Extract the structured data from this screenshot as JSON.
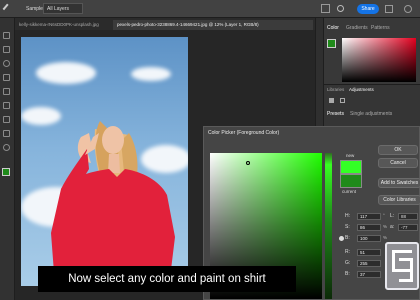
{
  "options": {
    "sample_label": "Sample:",
    "sample_value": "All Layers",
    "share": "Share"
  },
  "tabs": [
    {
      "label": "kelly-sikkema-rN6sDD0PK-unsplash.jpg"
    },
    {
      "label": "pexels-pedro-photo-3238869.4-14669421.jpg @ 12% (Layer 1, RGB/8)"
    }
  ],
  "panel": {
    "tabs": [
      "Color",
      "Gradients",
      "Patterns"
    ],
    "libtabs": [
      "Libraries",
      "Adjustments"
    ],
    "sub": [
      "Presets",
      "Single adjustments"
    ]
  },
  "dialog": {
    "title": "Color Picker (Foreground Color)",
    "new_label": "new",
    "current_label": "current",
    "ok": "OK",
    "cancel": "Cancel",
    "add_swatches": "Add to Swatches",
    "color_libraries": "Color Libraries",
    "fields": [
      {
        "label": "H:",
        "value": "117",
        "unit": "°"
      },
      {
        "label": "S:",
        "value": "86",
        "unit": "%"
      },
      {
        "label": "B:",
        "value": "100",
        "unit": "%"
      },
      {
        "label": "R:",
        "value": "51",
        "unit": ""
      },
      {
        "label": "G:",
        "value": "255",
        "unit": ""
      },
      {
        "label": "B:",
        "value": "37",
        "unit": ""
      }
    ],
    "lab": [
      {
        "label": "L:",
        "value": "88"
      },
      {
        "label": "a:",
        "value": "-77"
      }
    ],
    "new_color": "#33ff25",
    "current_color": "#1f8a1a"
  },
  "subtitle": "Now select any color and paint on shirt"
}
